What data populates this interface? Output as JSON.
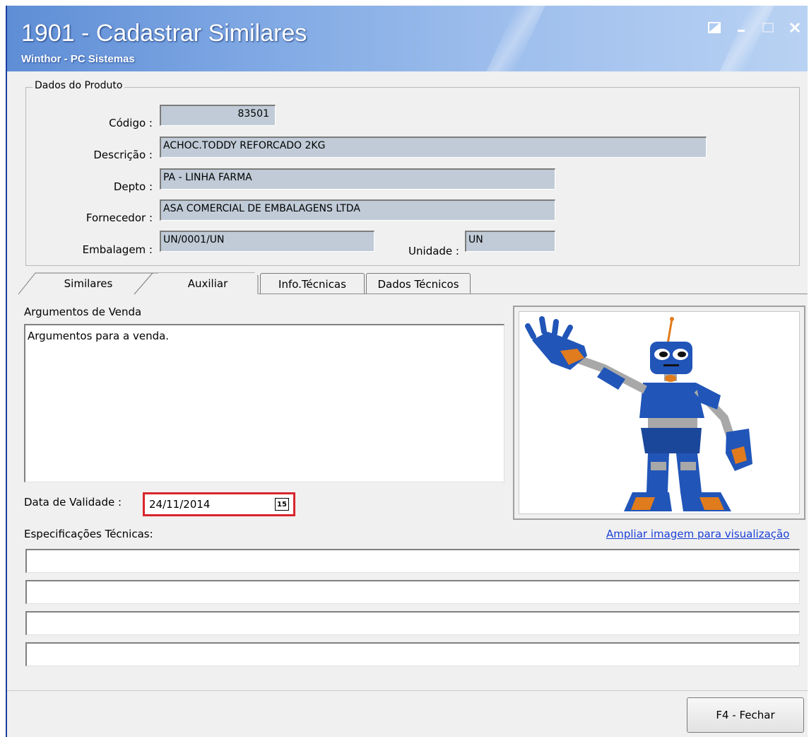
{
  "window": {
    "title": "1901 - Cadastrar Similares",
    "subtitle": "Winthor - PC Sistemas"
  },
  "product_group": {
    "legend": "Dados do Produto",
    "codigo_label": "Código :",
    "codigo_value": "83501",
    "descricao_label": "Descrição :",
    "descricao_value": "ACHOC.TODDY REFORCADO 2KG",
    "depto_label": "Depto :",
    "depto_value": "PA - LINHA FARMA",
    "fornecedor_label": "Fornecedor :",
    "fornecedor_value": "ASA COMERCIAL DE EMBALAGENS LTDA",
    "embalagem_label": "Embalagem :",
    "embalagem_value": "UN/0001/UN",
    "unidade_label": "Unidade :",
    "unidade_value": "UN"
  },
  "tabs": [
    {
      "label": "Similares"
    },
    {
      "label": "Auxiliar",
      "active": true
    },
    {
      "label": "Info.Técnicas"
    },
    {
      "label": "Dados Técnicos"
    }
  ],
  "auxiliar": {
    "argumentos_label": "Argumentos de Venda",
    "argumentos_value": "Argumentos para a venda.",
    "validade_label": "Data de Validade :",
    "validade_value": "24/11/2014",
    "calendar_text": "15",
    "specs_label": "Especificações Técnicas:",
    "image_link": "Ampliar imagem para visualização"
  },
  "footer": {
    "close_label": "F4 - Fechar"
  },
  "colors": {
    "titlebar": "#7ea7e3",
    "readonly_field": "#c0cbd7",
    "highlight": "#d9252c",
    "link": "#1a3fd6",
    "robot_blue": "#2155b8",
    "robot_orange": "#e07b1e",
    "robot_gray": "#a8a8a8"
  }
}
